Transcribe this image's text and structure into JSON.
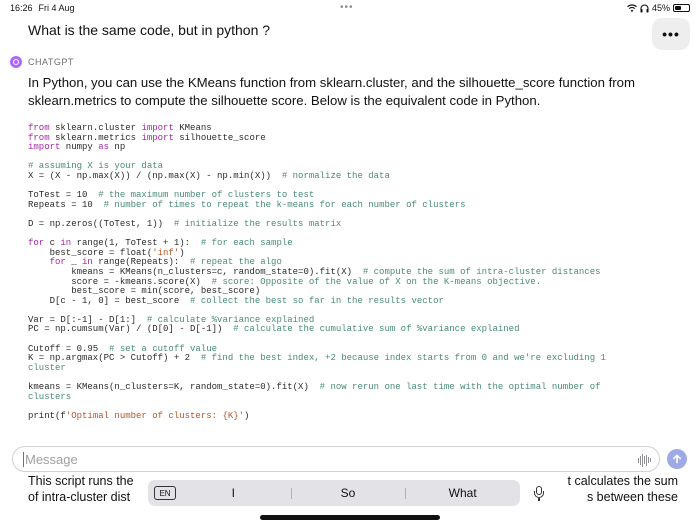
{
  "status_bar": {
    "time": "16:26",
    "date": "Fri 4 Aug",
    "battery": "45%",
    "battery_level": 0.45
  },
  "user_message": "What is the same code, but in python ?",
  "assistant": {
    "name": "CHATGPT",
    "intro": "In Python, you can use the KMeans function from sklearn.cluster, and the silhouette_score function from sklearn.metrics to compute the silhouette score. Below is the equivalent code in Python."
  },
  "code": [
    [
      {
        "t": "from",
        "k": "kw"
      },
      {
        "t": " sklearn.cluster "
      },
      {
        "t": "import",
        "k": "kw"
      },
      {
        "t": " KMeans"
      }
    ],
    [
      {
        "t": "from",
        "k": "kw"
      },
      {
        "t": " sklearn.metrics "
      },
      {
        "t": "import",
        "k": "kw"
      },
      {
        "t": " silhouette_score"
      }
    ],
    [
      {
        "t": "import",
        "k": "kw"
      },
      {
        "t": " numpy "
      },
      {
        "t": "as",
        "k": "kw"
      },
      {
        "t": " np"
      }
    ],
    [],
    [
      {
        "t": "# assuming X is your data",
        "k": "cm"
      }
    ],
    [
      {
        "t": "X = (X - np.max(X)) / (np.max(X) - np.min(X))  "
      },
      {
        "t": "# normalize the data",
        "k": "cm"
      }
    ],
    [],
    [
      {
        "t": "ToTest = 10  "
      },
      {
        "t": "# the maximum number of clusters to test",
        "k": "cm"
      }
    ],
    [
      {
        "t": "Repeats = 10  "
      },
      {
        "t": "# number of times to repeat the k-means for each number of clusters",
        "k": "cm"
      }
    ],
    [],
    [
      {
        "t": "D = np.zeros((ToTest, 1))  "
      },
      {
        "t": "# initialize the results matrix",
        "k": "cm"
      }
    ],
    [],
    [
      {
        "t": "for",
        "k": "kw"
      },
      {
        "t": " c "
      },
      {
        "t": "in",
        "k": "kw"
      },
      {
        "t": " range(1, ToTest + 1):  "
      },
      {
        "t": "# for each sample",
        "k": "cm"
      }
    ],
    [
      {
        "t": "    best_score = float("
      },
      {
        "t": "'inf'",
        "k": "st"
      },
      {
        "t": ")"
      }
    ],
    [
      {
        "t": "    "
      },
      {
        "t": "for",
        "k": "kw"
      },
      {
        "t": " _ "
      },
      {
        "t": "in",
        "k": "kw"
      },
      {
        "t": " range(Repeats):  "
      },
      {
        "t": "# repeat the algo",
        "k": "cm"
      }
    ],
    [
      {
        "t": "        kmeans = KMeans(n_clusters=c, random_state=0).fit(X)  "
      },
      {
        "t": "# compute the sum of intra-cluster distances",
        "k": "cm"
      }
    ],
    [
      {
        "t": "        score = -kmeans.score(X)  "
      },
      {
        "t": "# score: Opposite of the value of X on the K-means objective.",
        "k": "cm"
      }
    ],
    [
      {
        "t": "        best_score = min(score, best_score)"
      }
    ],
    [
      {
        "t": "    D[c - 1, 0] = best_score  "
      },
      {
        "t": "# collect the best so far in the results vector",
        "k": "cm"
      }
    ],
    [],
    [
      {
        "t": "Var = D[:-1] - D[1:]  "
      },
      {
        "t": "# calculate %variance explained",
        "k": "cm"
      }
    ],
    [
      {
        "t": "PC = np.cumsum(Var) / (D[0] - D[-1])  "
      },
      {
        "t": "# calculate the cumulative sum of %variance explained",
        "k": "cm"
      }
    ],
    [],
    [
      {
        "t": "Cutoff = 0.95  "
      },
      {
        "t": "# set a cutoff value",
        "k": "cm"
      }
    ],
    [
      {
        "t": "K = np.argmax(PC > Cutoff) + 2  "
      },
      {
        "t": "# find the best index, +2 because index starts from 0 and we're excluding 1",
        "k": "cm"
      }
    ],
    [
      {
        "t": "cluster",
        "k": "cm"
      }
    ],
    [],
    [
      {
        "t": "kmeans = KMeans(n_clusters=K, random_state=0).fit(X)  "
      },
      {
        "t": "# now rerun one last time with the optimal number of",
        "k": "cm"
      }
    ],
    [
      {
        "t": "clusters",
        "k": "cm"
      }
    ],
    [],
    [
      {
        "t": "print(f"
      },
      {
        "t": "'Optimal number of clusters: {K}'",
        "k": "st"
      },
      {
        "t": ")"
      }
    ]
  ],
  "input": {
    "placeholder": "Message"
  },
  "behind_text": {
    "line1_left": "This script runs the ",
    "line1_right": "t calculates the sum",
    "line2_left": "of intra-cluster dist",
    "line2_right": "s between these"
  },
  "keyboard": {
    "language": "EN",
    "suggestions": [
      "I",
      "So",
      "What"
    ]
  },
  "colors": {
    "accent": "#ab68ff",
    "send_button": "#9ea9e6",
    "code_keyword": "#a626a4",
    "code_comment": "#4a8a7a",
    "code_string": "#b5562b"
  }
}
